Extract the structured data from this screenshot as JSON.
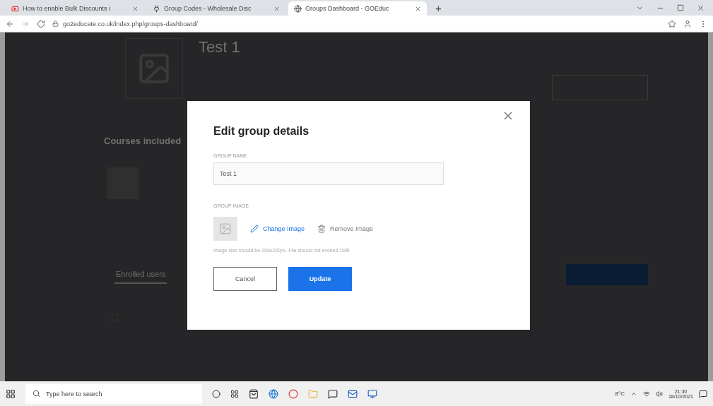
{
  "browser": {
    "tabs": [
      {
        "title": "How to enable Bulk Discounts i",
        "selected": false,
        "kind": "video"
      },
      {
        "title": "Group Codes - Wholesale Disc",
        "selected": false,
        "kind": "plugin"
      },
      {
        "title": "Groups Dashboard - GOEduc",
        "selected": true,
        "kind": "globe"
      }
    ],
    "new_tab": "+",
    "url": "go2educate.co.uk/index.php/groups-dashboard/"
  },
  "page": {
    "group_title": "Test 1",
    "courses_heading": "Courses included",
    "tabs": [
      {
        "label": "Enrolled users",
        "selected": true
      }
    ]
  },
  "modal": {
    "title": "Edit group details",
    "name_label": "GROUP NAME",
    "name_value": "Test 1",
    "image_label": "GROUP IMAGE",
    "change_image": "Change Image",
    "remove_image": "Remove Image",
    "hint": "Image size should be 200x200px. File should not exceed 1MB",
    "cancel": "Cancel",
    "update": "Update"
  },
  "taskbar": {
    "search_placeholder": "Type here to search",
    "temperature": "8°C",
    "time": "21:30",
    "date": "18/10/2021"
  }
}
